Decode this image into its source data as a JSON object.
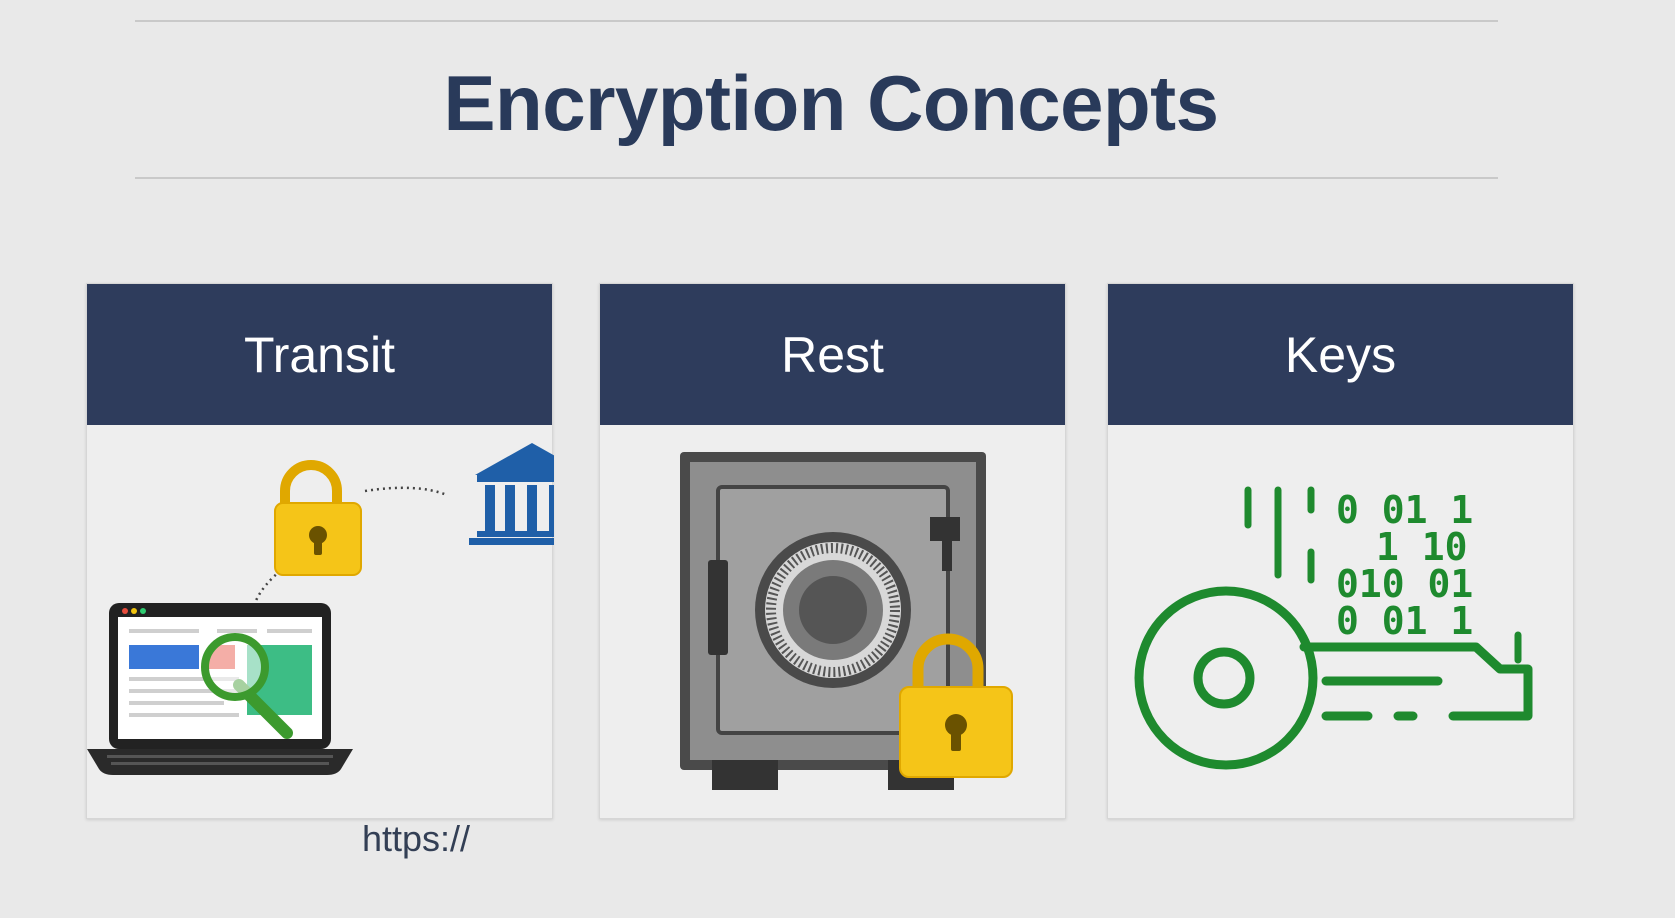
{
  "title": "Encryption Concepts",
  "cards": [
    {
      "label": "Transit",
      "https_text": "https://"
    },
    {
      "label": "Rest"
    },
    {
      "label": "Keys"
    }
  ],
  "binary_rows": [
    "0 01 1",
    "1 10",
    "010 01",
    "0 01 1"
  ],
  "colors": {
    "background": "#e9e9e9",
    "title": "#293a5a",
    "header": "#2e3c5c",
    "lock_gold": "#f5c518",
    "bank_blue": "#1f5fa8",
    "key_green": "#1e8a2e"
  },
  "icons": [
    "padlock-icon",
    "bank-icon",
    "laptop-icon",
    "magnifier-icon",
    "safe-icon",
    "key-icon"
  ]
}
